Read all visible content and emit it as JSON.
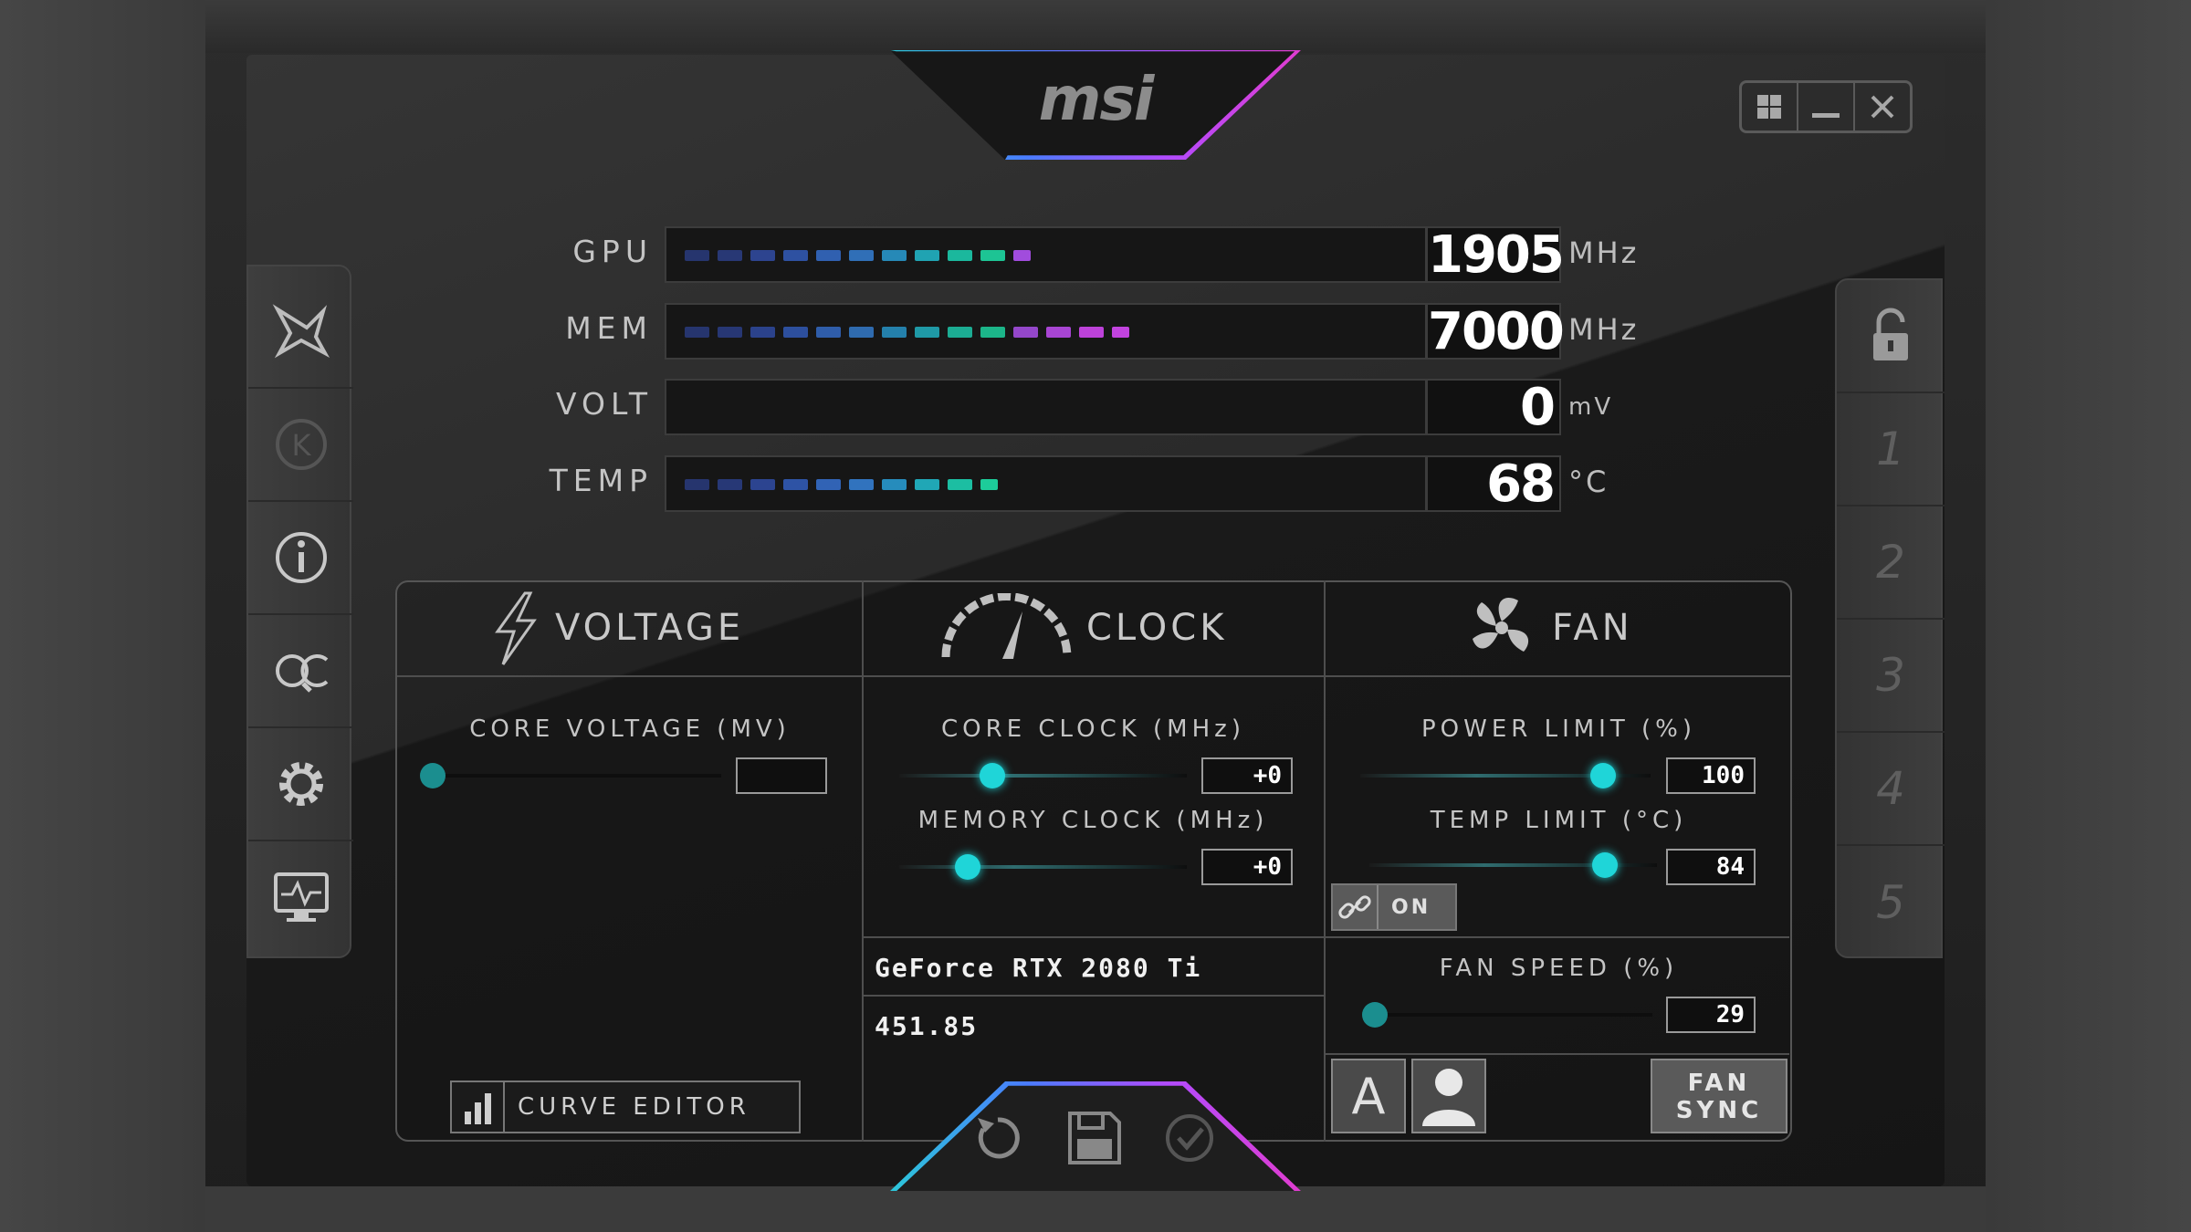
{
  "brand": {
    "logo_text": "msi"
  },
  "window_controls": {
    "windows_label": "⊞",
    "minimize_label": "—",
    "close_label": "✕"
  },
  "left_sidebar": {
    "items": [
      {
        "icon": "dragon-icon"
      },
      {
        "icon": "kombustor-icon",
        "label": "K"
      },
      {
        "icon": "info-icon"
      },
      {
        "icon": "oc-scanner-icon",
        "label": "OC"
      },
      {
        "icon": "settings-icon"
      },
      {
        "icon": "monitor-icon"
      }
    ]
  },
  "right_sidebar": {
    "lock_icon": "lock-open-icon",
    "profiles": [
      "1",
      "2",
      "3",
      "4",
      "5"
    ]
  },
  "meters": [
    {
      "label": "GPU",
      "value": "1905",
      "unit": "MHz",
      "fill": 0.5
    },
    {
      "label": "MEM",
      "value": "7000",
      "unit": "MHz",
      "fill": 0.62
    },
    {
      "label": "VOLT",
      "value": "0",
      "unit": "mV",
      "fill": 0
    },
    {
      "label": "TEMP",
      "value": "68",
      "unit": "°C",
      "fill": 0.45
    }
  ],
  "tabs": {
    "voltage": "VOLTAGE",
    "clock": "CLOCK",
    "fan": "FAN"
  },
  "voltage": {
    "core_voltage_label": "CORE VOLTAGE  (MV)",
    "core_voltage_value": "",
    "curve_editor_label": "CURVE EDITOR"
  },
  "clock": {
    "core_clock_label": "CORE CLOCK (MHz)",
    "core_clock_value": "+0",
    "memory_clock_label": "MEMORY CLOCK (MHz)",
    "memory_clock_value": "+0",
    "gpu_name": "GeForce RTX 2080 Ti",
    "driver_version": "451.85"
  },
  "fan": {
    "power_limit_label": "POWER LIMIT (%)",
    "power_limit_value": "100",
    "temp_limit_label": "TEMP LIMIT (°C)",
    "temp_limit_value": "84",
    "link_label": "ON",
    "fan_speed_label": "FAN SPEED (%)",
    "fan_speed_value": "29",
    "auto_label": "A",
    "fan_sync_line1": "FAN",
    "fan_sync_line2": "SYNC"
  },
  "colors": {
    "accent_cyan": "#1fd5d8",
    "segment_gradient": [
      "#3a58c8",
      "#3a78e8",
      "#2ab8d8",
      "#1ed0a8",
      "#b048e8",
      "#d040e0"
    ]
  }
}
